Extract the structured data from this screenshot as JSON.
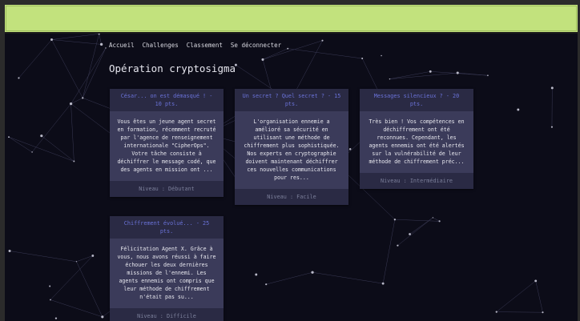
{
  "nav": {
    "items": [
      "Accueil",
      "Challenges",
      "Classement",
      "Se déconnecter"
    ]
  },
  "page": {
    "title": "Opération cryptosigma"
  },
  "challenges": [
    {
      "title": "César... on est démasqué ! - 10 pts.",
      "description": "Vous êtes un jeune agent secret en formation, récemment recruté par l'agence de renseignement internationale \"CipherOps\". Votre tâche consiste à déchiffrer le message codé, que des agents en mission ont ...",
      "level": "Niveau : Débutant"
    },
    {
      "title": "Un secret ? Quel secret ? - 15 pts.",
      "description": "L'organisation ennemie a amélioré sa sécurité en utilisant une méthode de chiffrement plus sophistiquée. Nos experts en cryptographie doivent maintenant déchiffrer ces nouvelles communications pour res...",
      "level": "Niveau : Facile"
    },
    {
      "title": "Messages silencieux ? - 20 pts.",
      "description": "Très bien ! Vos compétences en déchiffrement ont été reconnues. Cependant, les agents ennemis ont été alertés sur la vulnérabilité de leur méthode de chiffrement préc...",
      "level": "Niveau : Intermédiaire"
    },
    {
      "title": "Chiffrement évolué... - 25 pts.",
      "description": "Félicitation Agent X. Grâce à vous, nous avons réussi à faire échouer les deux dernières missions de l'ennemi. Les agents ennemis ont compris que leur méthode de chiffrement n'était pas su...",
      "level": "Niveau : Difficile"
    }
  ],
  "colors": {
    "topbar": "#c2e27d",
    "background": "#0c0c18",
    "card": "#3b3b5a",
    "card_header": "#2a2a44",
    "card_title": "#6a72d8"
  }
}
